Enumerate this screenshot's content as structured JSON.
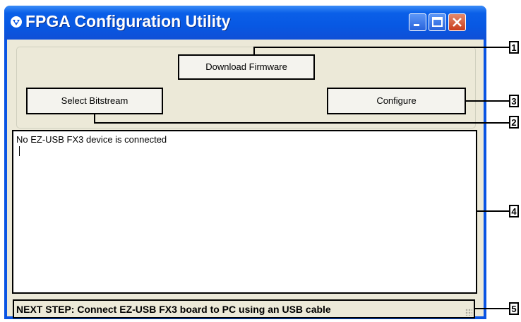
{
  "window": {
    "title": "FPGA Configuration Utility",
    "icon": "app-icon"
  },
  "buttons": {
    "download_firmware": "Download Firmware",
    "select_bitstream": "Select Bitstream",
    "configure": "Configure"
  },
  "log": {
    "text": "No EZ-USB  FX3 device is connected"
  },
  "status_bar": {
    "text": "NEXT STEP: Connect EZ-USB FX3 board to PC using an USB cable"
  },
  "callouts": [
    "1",
    "2",
    "3",
    "4",
    "5"
  ],
  "colors": {
    "title_bar": "#0a54e3",
    "client_bg": "#ece9d8",
    "close_button": "#c93c1c"
  }
}
